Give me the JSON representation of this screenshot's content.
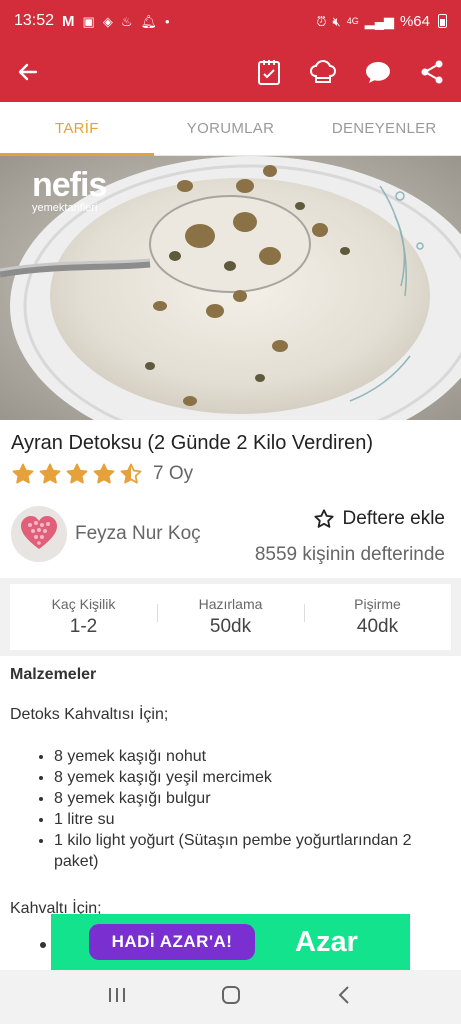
{
  "status_bar": {
    "time": "13:52",
    "battery": "%64",
    "net_label": "4G"
  },
  "tabs": [
    {
      "label": "TARİF",
      "active": true
    },
    {
      "label": "YORUMLAR",
      "active": false
    },
    {
      "label": "DENEYENLER",
      "active": false
    }
  ],
  "hero": {
    "brand": "nefis",
    "brand_sub": "yemektarifleri"
  },
  "recipe": {
    "title": "Ayran Detoksu (2 Günde 2 Kilo Verdiren)",
    "rating": 4.5,
    "rating_max": 5,
    "votes": "7 Oy",
    "author": "Feyza Nur Koç",
    "add_notebook_label": "Deftere ekle",
    "notebook_count": "8559 kişinin defterinde"
  },
  "stats": [
    {
      "label": "Kaç Kişilik",
      "value": "1-2"
    },
    {
      "label": "Hazırlama",
      "value": "50dk"
    },
    {
      "label": "Pişirme",
      "value": "40dk"
    }
  ],
  "ingredients": {
    "section_title": "Malzemeler",
    "group1_title": "Detoks Kahvaltısı İçin;",
    "group1_items": [
      "8 yemek kaşığı nohut",
      "8 yemek kaşığı yeşil mercimek",
      "8 yemek kaşığı bulgur",
      "1 litre su",
      "1 kilo light yoğurt (Sütaşın pembe yoğurtlarından 2 paket)"
    ],
    "group2_title": "Kahvaltı İçin;"
  },
  "ad": {
    "cta": "HADİ AZAR'A!",
    "brand": "Azar"
  },
  "colors": {
    "brand_red": "#d32d3b",
    "tab_active": "#e7a13a",
    "star": "#e7a13a",
    "ad_green": "#14e38e",
    "ad_purple": "#7a2fd0"
  }
}
